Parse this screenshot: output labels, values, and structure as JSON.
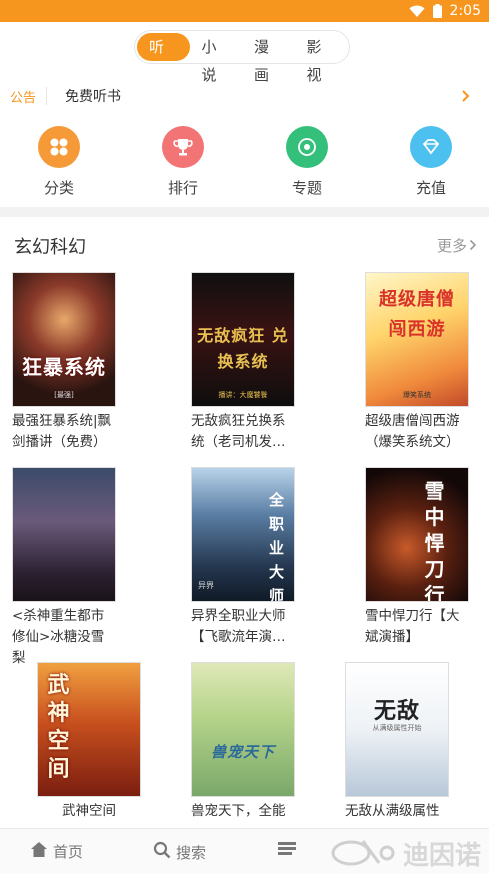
{
  "status": {
    "time": "2:05"
  },
  "segmented": {
    "tabs": [
      "听书",
      "小说",
      "漫画",
      "影视"
    ],
    "active": "听书"
  },
  "notice": {
    "tag": "公告",
    "text": "免费听书"
  },
  "categories": [
    {
      "label": "分类",
      "icon": "grid-icon",
      "color": "#f59a36"
    },
    {
      "label": "排行",
      "icon": "trophy-icon",
      "color": "#f27474"
    },
    {
      "label": "专题",
      "icon": "topic-icon",
      "color": "#34c07a"
    },
    {
      "label": "充值",
      "icon": "diamond-icon",
      "color": "#4cc0ee"
    }
  ],
  "section": {
    "title": "玄幻科幻",
    "more": "更多"
  },
  "books": [
    {
      "title": "最强狂暴系统|飘剑播讲（免费）",
      "cover_text": "狂暴系统",
      "cover_sub": "[最强]"
    },
    {
      "title": "无敌疯狂兑换系统（老司机发…",
      "cover_text": "无敌疯狂 兑换系统",
      "cover_sub": "播讲：大魔饕餮"
    },
    {
      "title": "超级唐僧闯西游（爆笑系统文）",
      "cover_text": "超级唐僧闯西游",
      "cover_sub": "爆笑系统"
    },
    {
      "title": "<杀神重生都市修仙>冰糖没雪梨",
      "cover_text": "",
      "cover_sub": ""
    },
    {
      "title": "异界全职业大师【飞歌流年演…",
      "cover_text": "全职业大师",
      "cover_sub": "异界"
    },
    {
      "title": "雪中悍刀行【大斌演播】",
      "cover_text": "雪中悍刀行",
      "cover_sub": ""
    },
    {
      "title": "武神空间",
      "cover_text": "武神空间",
      "cover_sub": ""
    },
    {
      "title": "兽宠天下，全能",
      "cover_text": "兽宠天下",
      "cover_sub": ""
    },
    {
      "title": "无敌从满级属性",
      "cover_text": "无敌",
      "cover_sub": "从满级属性开始"
    }
  ],
  "tabbar": {
    "items": [
      "首页",
      "搜索",
      ""
    ]
  },
  "watermark": {
    "text": "迪因诺"
  }
}
